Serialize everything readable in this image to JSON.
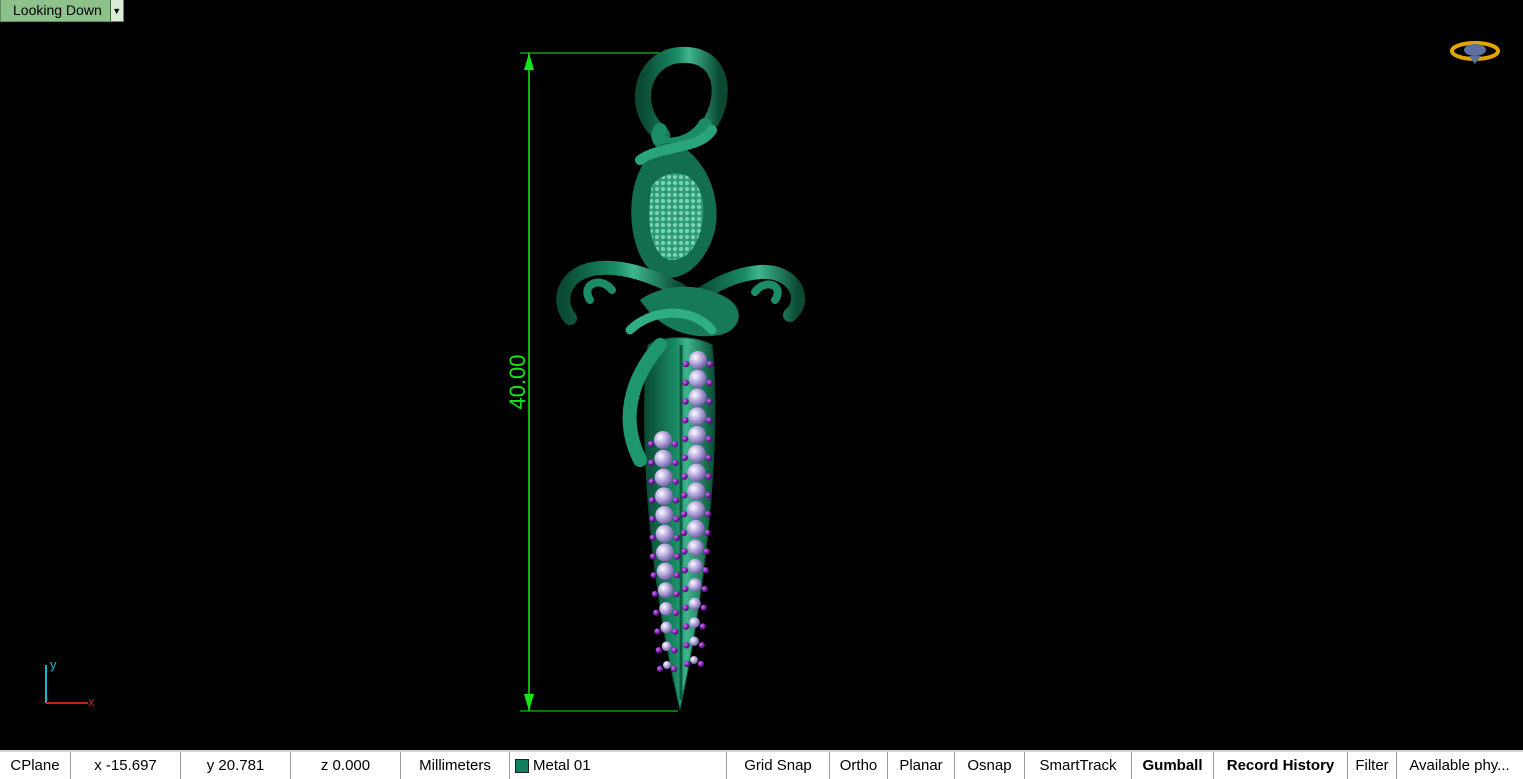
{
  "viewport": {
    "title": "Looking Down",
    "dimension_value": "40.00",
    "axis": {
      "y": "y",
      "x": "x"
    }
  },
  "status": {
    "cplane": "CPlane",
    "x": "x -15.697",
    "y": "y 20.781",
    "z": "z 0.000",
    "units": "Millimeters",
    "layer": "Metal 01",
    "grid_snap": "Grid Snap",
    "ortho": "Ortho",
    "planar": "Planar",
    "osnap": "Osnap",
    "smarttrack": "SmartTrack",
    "gumball": "Gumball",
    "record_history": "Record History",
    "filter": "Filter",
    "available": "Available phy..."
  },
  "colors": {
    "metal": "#11704f",
    "dimension": "#14e814",
    "gem_large": "#b6a8de",
    "gem_small": "#7d1bb0",
    "layer_swatch": "#0f7f5f"
  }
}
